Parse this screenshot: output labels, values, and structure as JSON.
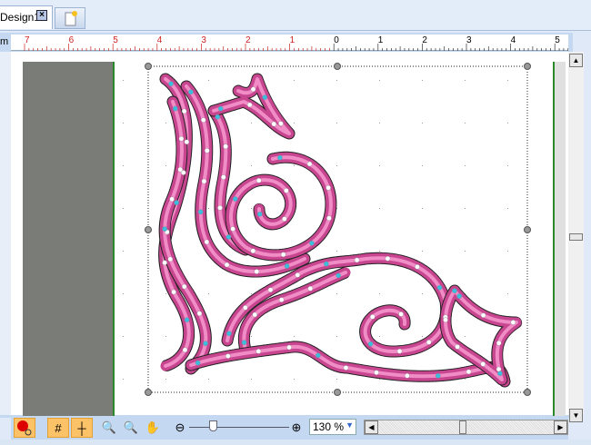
{
  "tabs": [
    {
      "label": "Design1",
      "close_icon": "close-x-icon"
    },
    {
      "icon": "new-document-icon"
    }
  ],
  "ruler": {
    "unit": "m",
    "labels": [
      {
        "text": "7",
        "neg": true
      },
      {
        "text": "6",
        "neg": true
      },
      {
        "text": "5",
        "neg": true
      },
      {
        "text": "4",
        "neg": true
      },
      {
        "text": "3",
        "neg": true
      },
      {
        "text": "2",
        "neg": true
      },
      {
        "text": "1",
        "neg": true
      },
      {
        "text": "0",
        "neg": false
      },
      {
        "text": "1",
        "neg": false
      },
      {
        "text": "2",
        "neg": false
      },
      {
        "text": "3",
        "neg": false
      },
      {
        "text": "4",
        "neg": false
      },
      {
        "text": "5",
        "neg": false
      }
    ]
  },
  "colors": {
    "stitch": "#c8458f",
    "stitch_highlight": "#f08cc6",
    "node_blue": "#3bbde0",
    "negative_ruler": "#cc2222"
  },
  "toolbar": {
    "tools": [
      "show-points-icon",
      "grid-icon",
      "guides-icon",
      "zoom-page-icon",
      "zoom-fit-icon",
      "hand-pan-icon"
    ],
    "zoom_value": "130 %",
    "zoom_level_percent": 130
  }
}
